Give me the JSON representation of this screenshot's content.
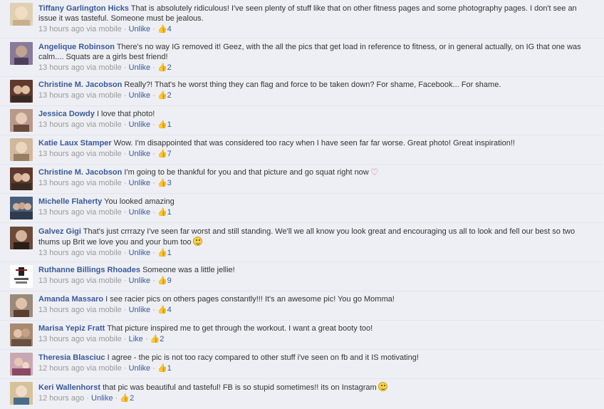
{
  "comments": [
    {
      "author": "Tiffany Garlington Hicks",
      "text": "That is absolutely ridiculous! I've seen plenty of stuff like that on other fitness pages and some photography pages. I don't see an issue it was tasteful. Someone must be jealous.",
      "time": "13 hours ago via mobile",
      "action": "Unlike",
      "likes": "4",
      "avatar_color": "#d9c7a8"
    },
    {
      "author": "Angelique Robinson",
      "text": "There's no way IG removed it! Geez, with the all the pics that get load in reference to fitness, or in general actually, on IG that one was calm.... Squats are a girls best friend!",
      "time": "13 hours ago via mobile",
      "action": "Unlike",
      "likes": "2",
      "avatar_color": "#7d6b8a"
    },
    {
      "author": "Christine M. Jacobson",
      "text": "Really?! That's he worst thing they can flag and force to be taken down? For shame, Facebook... For shame.",
      "time": "13 hours ago via mobile",
      "action": "Unlike",
      "likes": "2",
      "avatar_color": "#5e3a2e"
    },
    {
      "author": "Jessica Dowdy",
      "text": "I love that photo!",
      "time": "13 hours ago via mobile",
      "action": "Unlike",
      "likes": "1",
      "avatar_color": "#a8877a"
    },
    {
      "author": "Katie Laux Stamper",
      "text": "Wow. I'm disappointed that was considered too racy when I have seen far far worse. Great photo! Great inspiration!!",
      "time": "13 hours ago via mobile",
      "action": "Unlike",
      "likes": "7",
      "avatar_color": "#c4a88c"
    },
    {
      "author": "Christine M. Jacobson",
      "text": "I'm going to be thankful for you and that picture and go squat right now",
      "emoji": "heart",
      "time": "13 hours ago via mobile",
      "action": "Unlike",
      "likes": "3",
      "avatar_color": "#5e3a2e"
    },
    {
      "author": "Michelle Flaherty",
      "text": "You looked amazing",
      "time": "13 hours ago via mobile",
      "action": "Unlike",
      "likes": "1",
      "avatar_color": "#4a5e7a"
    },
    {
      "author": "Galvez Gigi",
      "text": "That's just crrrazy I've seen far worst and still standing. We'll we all know you look great and encouraging us all to look and fell our best so two thums up Brit we love you and your bum too",
      "emoji": "smile",
      "time": "13 hours ago via mobile",
      "action": "Unlike",
      "likes": "1",
      "avatar_color": "#6b4a3a"
    },
    {
      "author": "Ruthanne Billings Rhoades",
      "text": "Someone was a little jellie!",
      "time": "13 hours ago via mobile",
      "action": "Unlike",
      "likes": "9",
      "avatar_color": "#ffffff"
    },
    {
      "author": "Amanda Massaro",
      "text": "I see racier pics on others pages constantly!!! It's an awesome pic! You go Momma!",
      "time": "13 hours ago via mobile",
      "action": "Unlike",
      "likes": "4",
      "avatar_color": "#8c6a55"
    },
    {
      "author": "Marisa Yepiz Fratt",
      "text": "That picture inspired me to get through the workout. I want a great booty too!",
      "time": "13 hours ago via mobile",
      "action": "Like",
      "likes": "2",
      "avatar_color": "#9a7a62"
    },
    {
      "author": "Theresia Blasciuc",
      "text": "I agree - the pic is not too racy compared to other stuff i've seen on fb and it IS motivating!",
      "time": "12 hours ago via mobile",
      "action": "Unlike",
      "likes": "1",
      "avatar_color": "#b08a9a"
    },
    {
      "author": "Keri Wallenhorst",
      "text": "that pic was beautiful and tasteful! FB is so stupid sometimes!! its on Instagram",
      "emoji": "smile",
      "time": "12 hours ago",
      "action": "Unlike",
      "likes": "2",
      "avatar_color": "#c9b28a"
    }
  ],
  "meta_separator": "·",
  "like_icon": "thumbs-up-icon"
}
